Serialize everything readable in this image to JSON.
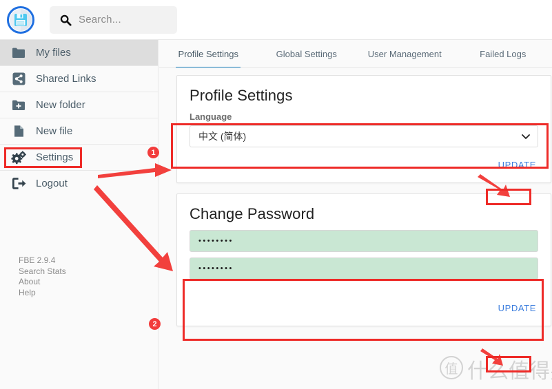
{
  "app": {
    "logo_icon": "save-floppy-disk-icon",
    "version": "FBE 2.9.4"
  },
  "search": {
    "icon": "search-icon",
    "placeholder": "Search..."
  },
  "sidebar": {
    "items": [
      {
        "label": "My files",
        "icon": "folder-icon",
        "active": true
      },
      {
        "label": "Shared Links",
        "icon": "share-icon",
        "active": false
      },
      {
        "label": "New folder",
        "icon": "folder-plus-icon",
        "active": false
      },
      {
        "label": "New file",
        "icon": "file-icon",
        "active": false
      },
      {
        "label": "Settings",
        "icon": "gears-icon",
        "active": false
      },
      {
        "label": "Logout",
        "icon": "logout-icon",
        "active": false
      }
    ],
    "footer": [
      {
        "label": "FBE 2.9.4"
      },
      {
        "label": "Search Stats"
      },
      {
        "label": "About"
      },
      {
        "label": "Help"
      }
    ]
  },
  "main": {
    "tabs": [
      {
        "label": "Profile Settings",
        "active": true
      },
      {
        "label": "Global Settings",
        "active": false
      },
      {
        "label": "User Management",
        "active": false
      },
      {
        "label": "Failed Logs",
        "active": false
      }
    ],
    "profile_card": {
      "title": "Profile Settings",
      "language_label": "Language",
      "language_value": "中文 (简体)",
      "chevron_icon": "chevron-down-icon",
      "update_label": "UPDATE"
    },
    "password_card": {
      "title": "Change Password",
      "new_password_value": "••••••••",
      "confirm_password_value": "••••••••",
      "update_label": "UPDATE"
    }
  },
  "annotations": {
    "accent_color": "#ee2b28",
    "badges": [
      {
        "number": "1"
      },
      {
        "number": "2"
      }
    ]
  },
  "watermark": {
    "mark": "值",
    "text": "什么值得买"
  }
}
